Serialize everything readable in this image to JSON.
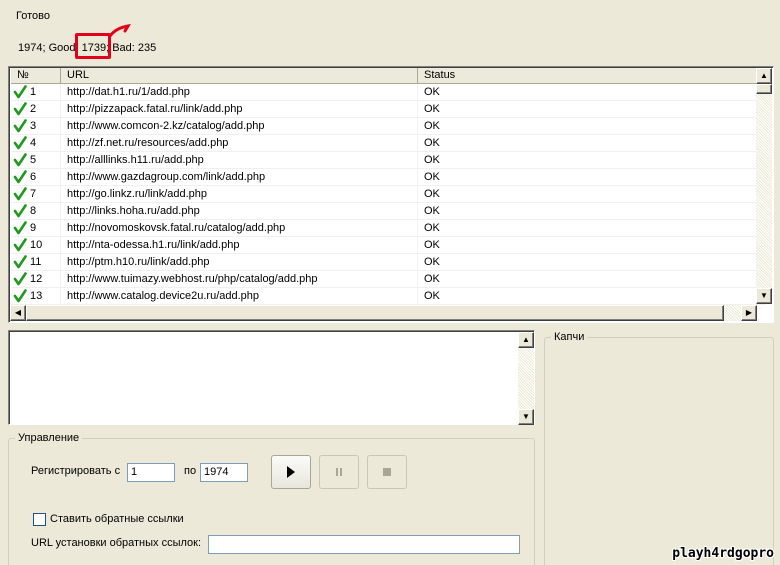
{
  "status": {
    "title": "Готово",
    "stats_total": "1974; Good: ",
    "stats_good": "1739;",
    "stats_bad": " Bad: 235"
  },
  "list": {
    "columns": {
      "num": "№",
      "url": "URL",
      "status": "Status"
    },
    "rows": [
      {
        "num": "1",
        "url": "http://dat.h1.ru/1/add.php",
        "status": "OK"
      },
      {
        "num": "2",
        "url": "http://pizzapack.fatal.ru/link/add.php",
        "status": "OK"
      },
      {
        "num": "3",
        "url": "http://www.comcon-2.kz/catalog/add.php",
        "status": "OK"
      },
      {
        "num": "4",
        "url": "http://zf.net.ru/resources/add.php",
        "status": "OK"
      },
      {
        "num": "5",
        "url": "http://alllinks.h11.ru/add.php",
        "status": "OK"
      },
      {
        "num": "6",
        "url": "http://www.gazdagroup.com/link/add.php",
        "status": "OK"
      },
      {
        "num": "7",
        "url": "http://go.linkz.ru/link/add.php",
        "status": "OK"
      },
      {
        "num": "8",
        "url": "http://links.hoha.ru/add.php",
        "status": "OK"
      },
      {
        "num": "9",
        "url": "http://novomoskovsk.fatal.ru/catalog/add.php",
        "status": "OK"
      },
      {
        "num": "10",
        "url": "http://nta-odessa.h1.ru/link/add.php",
        "status": "OK"
      },
      {
        "num": "11",
        "url": "http://ptm.h10.ru/link/add.php",
        "status": "OK"
      },
      {
        "num": "12",
        "url": "http://www.tuimazy.webhost.ru/php/catalog/add.php",
        "status": "OK"
      },
      {
        "num": "13",
        "url": "http://www.catalog.device2u.ru/add.php",
        "status": "OK"
      }
    ]
  },
  "log": {
    "value": ""
  },
  "captcha": {
    "title": "Капчи"
  },
  "control": {
    "title": "Управление",
    "register_from_label": "Регистрировать с",
    "register_from_value": "1",
    "register_to_label": "по",
    "register_to_value": "1974",
    "backlinks_label": "Ставить обратные ссылки",
    "backlinks_url_label": "URL установки обратных ссылок:",
    "backlinks_url_value": "",
    "play_icon": "play-icon",
    "pause_icon": "pause-icon",
    "stop_icon": "stop-icon"
  },
  "watermark": {
    "text": "playh4rdgopro"
  },
  "colors": {
    "window_bg": "#ece9d8",
    "highlight": "#e3001b",
    "check_green": "#1e9a1e"
  }
}
